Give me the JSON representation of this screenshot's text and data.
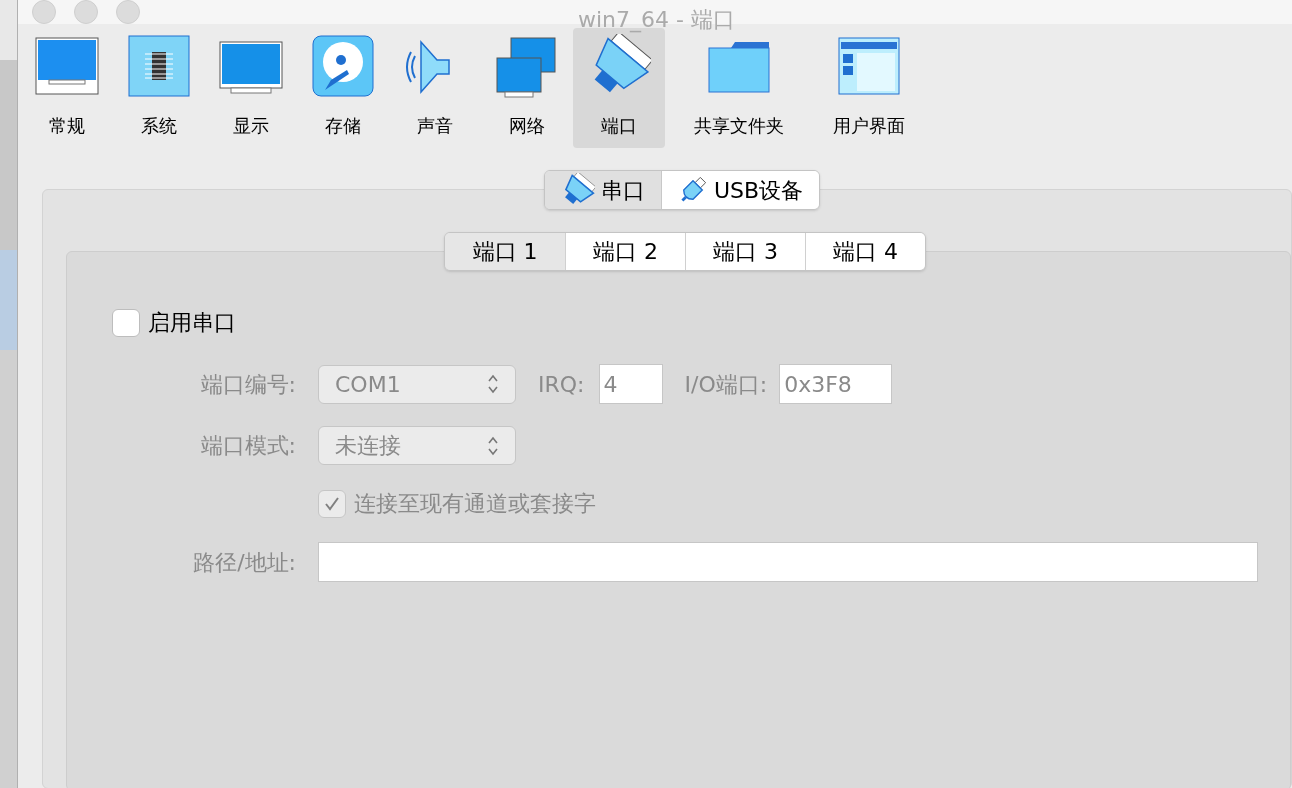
{
  "window": {
    "title": "win7_64 - 端口"
  },
  "toolbar": [
    {
      "label": "常规",
      "kind": "general",
      "selected": false
    },
    {
      "label": "系统",
      "kind": "system",
      "selected": false
    },
    {
      "label": "显示",
      "kind": "display",
      "selected": false
    },
    {
      "label": "存储",
      "kind": "storage",
      "selected": false
    },
    {
      "label": "声音",
      "kind": "audio",
      "selected": false
    },
    {
      "label": "网络",
      "kind": "network",
      "selected": false
    },
    {
      "label": "端口",
      "kind": "ports",
      "selected": true
    },
    {
      "label": "共享文件夹",
      "kind": "folder",
      "selected": false
    },
    {
      "label": "用户界面",
      "kind": "ui",
      "selected": false
    }
  ],
  "section_tabs": [
    {
      "label": "串口",
      "kind": "serial",
      "selected": true
    },
    {
      "label": "USB设备",
      "kind": "usb",
      "selected": false
    }
  ],
  "port_tabs": [
    {
      "label": "端口 1",
      "selected": true
    },
    {
      "label": "端口 2",
      "selected": false
    },
    {
      "label": "端口 3",
      "selected": false
    },
    {
      "label": "端口 4",
      "selected": false
    }
  ],
  "enable": {
    "label": "启用串口",
    "checked": false
  },
  "settings": {
    "disabled": true,
    "port_number": {
      "label": "端口编号:",
      "value": "COM1"
    },
    "irq": {
      "label": "IRQ:",
      "value": "4"
    },
    "io_port": {
      "label": "I/O端口:",
      "value": "0x3F8"
    },
    "port_mode": {
      "label": "端口模式:",
      "value": "未连接"
    },
    "connect_existing": {
      "label": "连接至现有通道或套接字",
      "checked": true
    },
    "path": {
      "label": "路径/地址:"
    }
  }
}
